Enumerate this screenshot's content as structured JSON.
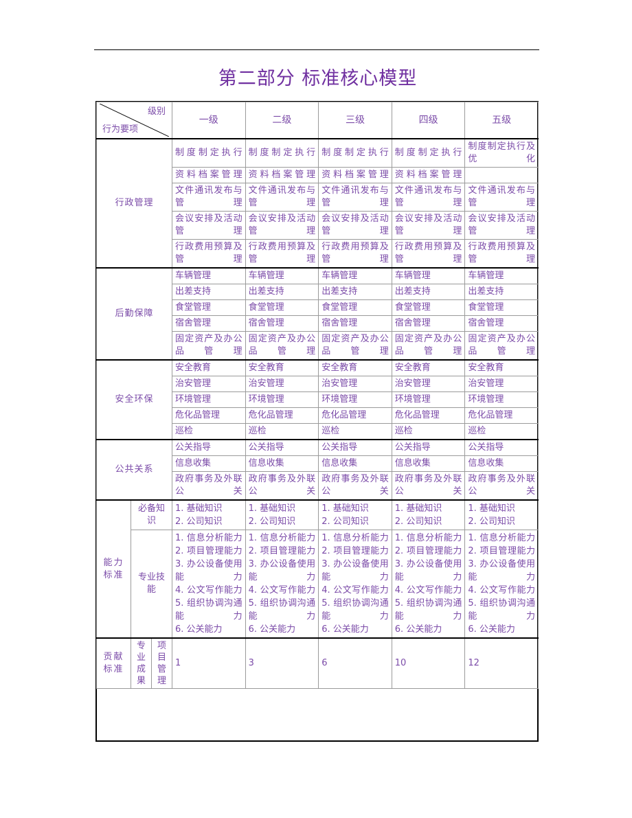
{
  "document": {
    "title": "第二部分  标准核心模型",
    "title_color": "#7030A0",
    "body_color": "#7B4BA8"
  },
  "table": {
    "corner": {
      "top_right_label": "级别",
      "bottom_left_label": "行为要项"
    },
    "levels": [
      "一级",
      "二级",
      "三级",
      "四级",
      "五级"
    ],
    "groups": [
      {
        "label": "行政管理",
        "rows": [
          {
            "cells": [
              "制度制定执行",
              "制度制定执行",
              "制度制定执行",
              "制度制定执行",
              "制度制定执行及优化"
            ]
          },
          {
            "cells": [
              "资料档案管理",
              "资料档案管理",
              "资料档案管理",
              "资料档案管理",
              ""
            ]
          },
          {
            "cells": [
              "文件通讯发布与管理",
              "文件通讯发布与管理",
              "文件通讯发布与管理",
              "文件通讯发布与管理",
              "文件通讯发布与管理"
            ]
          },
          {
            "cells": [
              "会议安排及活动管理",
              "会议安排及活动管理",
              "会议安排及活动管理",
              "会议安排及活动管理",
              "会议安排及活动管理"
            ]
          },
          {
            "cells": [
              "行政费用预算及管理",
              "行政费用预算及管理",
              "行政费用预算及管理",
              "行政费用预算及管理",
              "行政费用预算及管理"
            ]
          }
        ]
      },
      {
        "label": "后勤保障",
        "rows": [
          {
            "cells": [
              "车辆管理",
              "车辆管理",
              "车辆管理",
              "车辆管理",
              "车辆管理"
            ]
          },
          {
            "cells": [
              "出差支持",
              "出差支持",
              "出差支持",
              "出差支持",
              "出差支持"
            ]
          },
          {
            "cells": [
              "食堂管理",
              "食堂管理",
              "食堂管理",
              "食堂管理",
              "食堂管理"
            ]
          },
          {
            "cells": [
              "宿舍管理",
              "宿舍管理",
              "宿舍管理",
              "宿舍管理",
              "宿舍管理"
            ]
          },
          {
            "cells": [
              "固定资产及办公品管理",
              "固定资产及办公品管理",
              "固定资产及办公品管理",
              "固定资产及办公品管理",
              "固定资产及办公品管理"
            ]
          }
        ]
      },
      {
        "label": "安全环保",
        "rows": [
          {
            "cells": [
              "安全教育",
              "安全教育",
              "安全教育",
              "安全教育",
              "安全教育"
            ]
          },
          {
            "cells": [
              "治安管理",
              "治安管理",
              "治安管理",
              "治安管理",
              "治安管理"
            ]
          },
          {
            "cells": [
              "环境管理",
              "环境管理",
              "环境管理",
              "环境管理",
              "环境管理"
            ]
          },
          {
            "cells": [
              "危化品管理",
              "危化品管理",
              "危化品管理",
              "危化品管理",
              "危化品管理"
            ]
          },
          {
            "cells": [
              "巡检",
              "巡检",
              "巡检",
              "巡检",
              "巡检"
            ]
          }
        ]
      },
      {
        "label": "公共关系",
        "rows": [
          {
            "cells": [
              "公关指导",
              "公关指导",
              "公关指导",
              "公关指导",
              "公关指导"
            ]
          },
          {
            "cells": [
              "信息收集",
              "信息收集",
              "信息收集",
              "信息收集",
              "信息收集"
            ]
          },
          {
            "cells": [
              "政府事务及外联公关",
              "政府事务及外联公关",
              "政府事务及外联公关",
              "政府事务及外联公关",
              "政府事务及外联公关"
            ]
          }
        ]
      }
    ],
    "ability": {
      "label": "能力标准",
      "sub_rows": [
        {
          "label": "必备知识",
          "items": [
            "1. 基础知识",
            "2. 公司知识"
          ]
        },
        {
          "label": "专业技能",
          "items": [
            "1. 信息分析能力",
            "2. 项目管理能力",
            "3. 办公设备使用能力",
            "4. 公文写作能力",
            "5. 组织协调沟通能力",
            "6. 公关能力"
          ]
        }
      ]
    },
    "contribution": {
      "label": "贡献标准",
      "sub_label_1": "专业成果",
      "sub_label_2": "项目管理",
      "values": [
        "1",
        "3",
        "6",
        "10",
        "12"
      ]
    }
  }
}
